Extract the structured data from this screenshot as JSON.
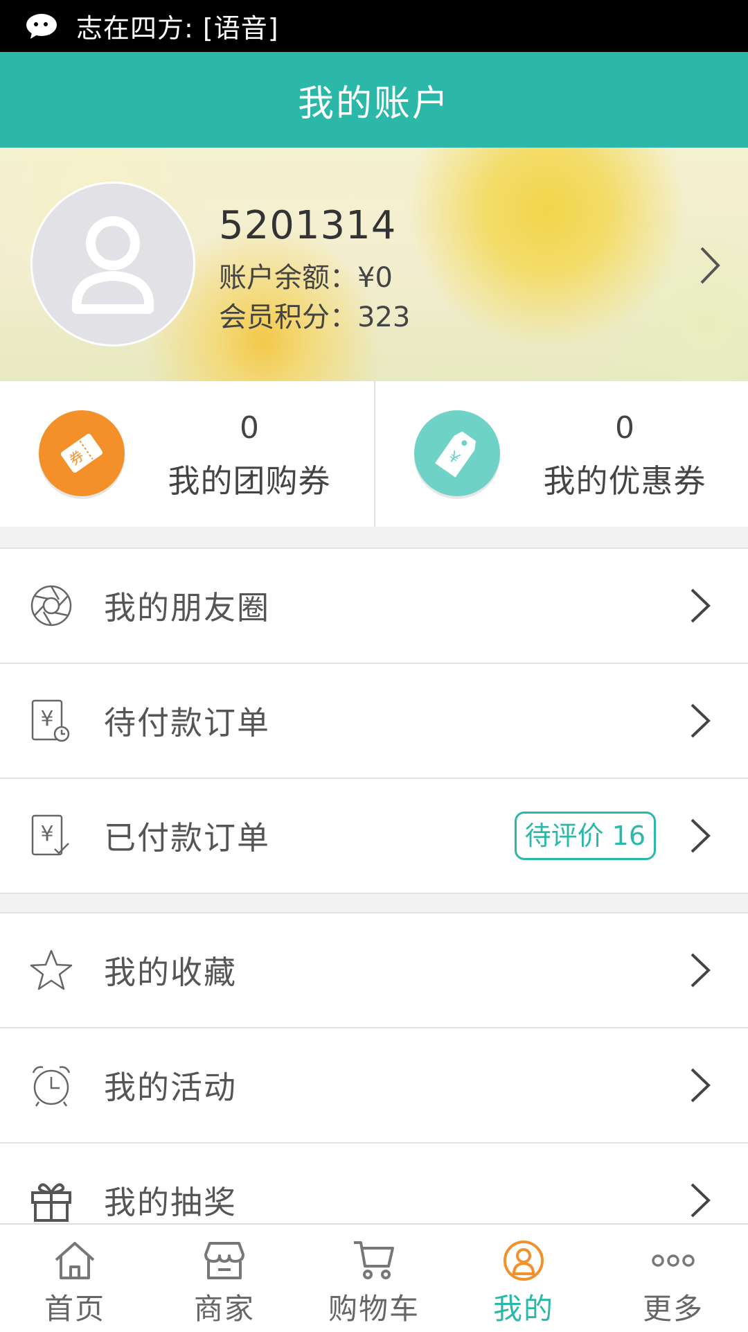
{
  "status_bar": {
    "notification": "志在四方: [语音]",
    "app_icon": "wechat-icon"
  },
  "header": {
    "title": "我的账户"
  },
  "profile": {
    "user_id": "5201314",
    "balance": "账户余额：¥0",
    "points": "会员积分：323",
    "avatar_icon": "user-avatar-icon"
  },
  "coupons": [
    {
      "count": "0",
      "label": "我的团购券",
      "icon": "ticket-icon",
      "color": "#f4902a"
    },
    {
      "count": "0",
      "label": "我的优惠券",
      "icon": "price-tag-icon",
      "color": "#6fd2c6"
    }
  ],
  "menu_group_1": [
    {
      "label": "我的朋友圈",
      "icon": "aperture-icon"
    },
    {
      "label": "待付款订单",
      "icon": "unpaid-order-icon"
    },
    {
      "label": "已付款订单",
      "icon": "paid-order-icon",
      "badge": "待评价 16"
    }
  ],
  "menu_group_2": [
    {
      "label": "我的收藏",
      "icon": "star-icon"
    },
    {
      "label": "我的活动",
      "icon": "alarm-clock-icon"
    },
    {
      "label": "我的抽奖",
      "icon": "gift-icon"
    }
  ],
  "tabbar": [
    {
      "label": "首页",
      "icon": "home-icon"
    },
    {
      "label": "商家",
      "icon": "store-icon"
    },
    {
      "label": "购物车",
      "icon": "cart-icon"
    },
    {
      "label": "我的",
      "icon": "person-icon",
      "active": true
    },
    {
      "label": "更多",
      "icon": "more-icon"
    }
  ],
  "colors": {
    "accent": "#2cb8a8",
    "orange": "#f4902a",
    "active_icon": "#f4902a"
  }
}
